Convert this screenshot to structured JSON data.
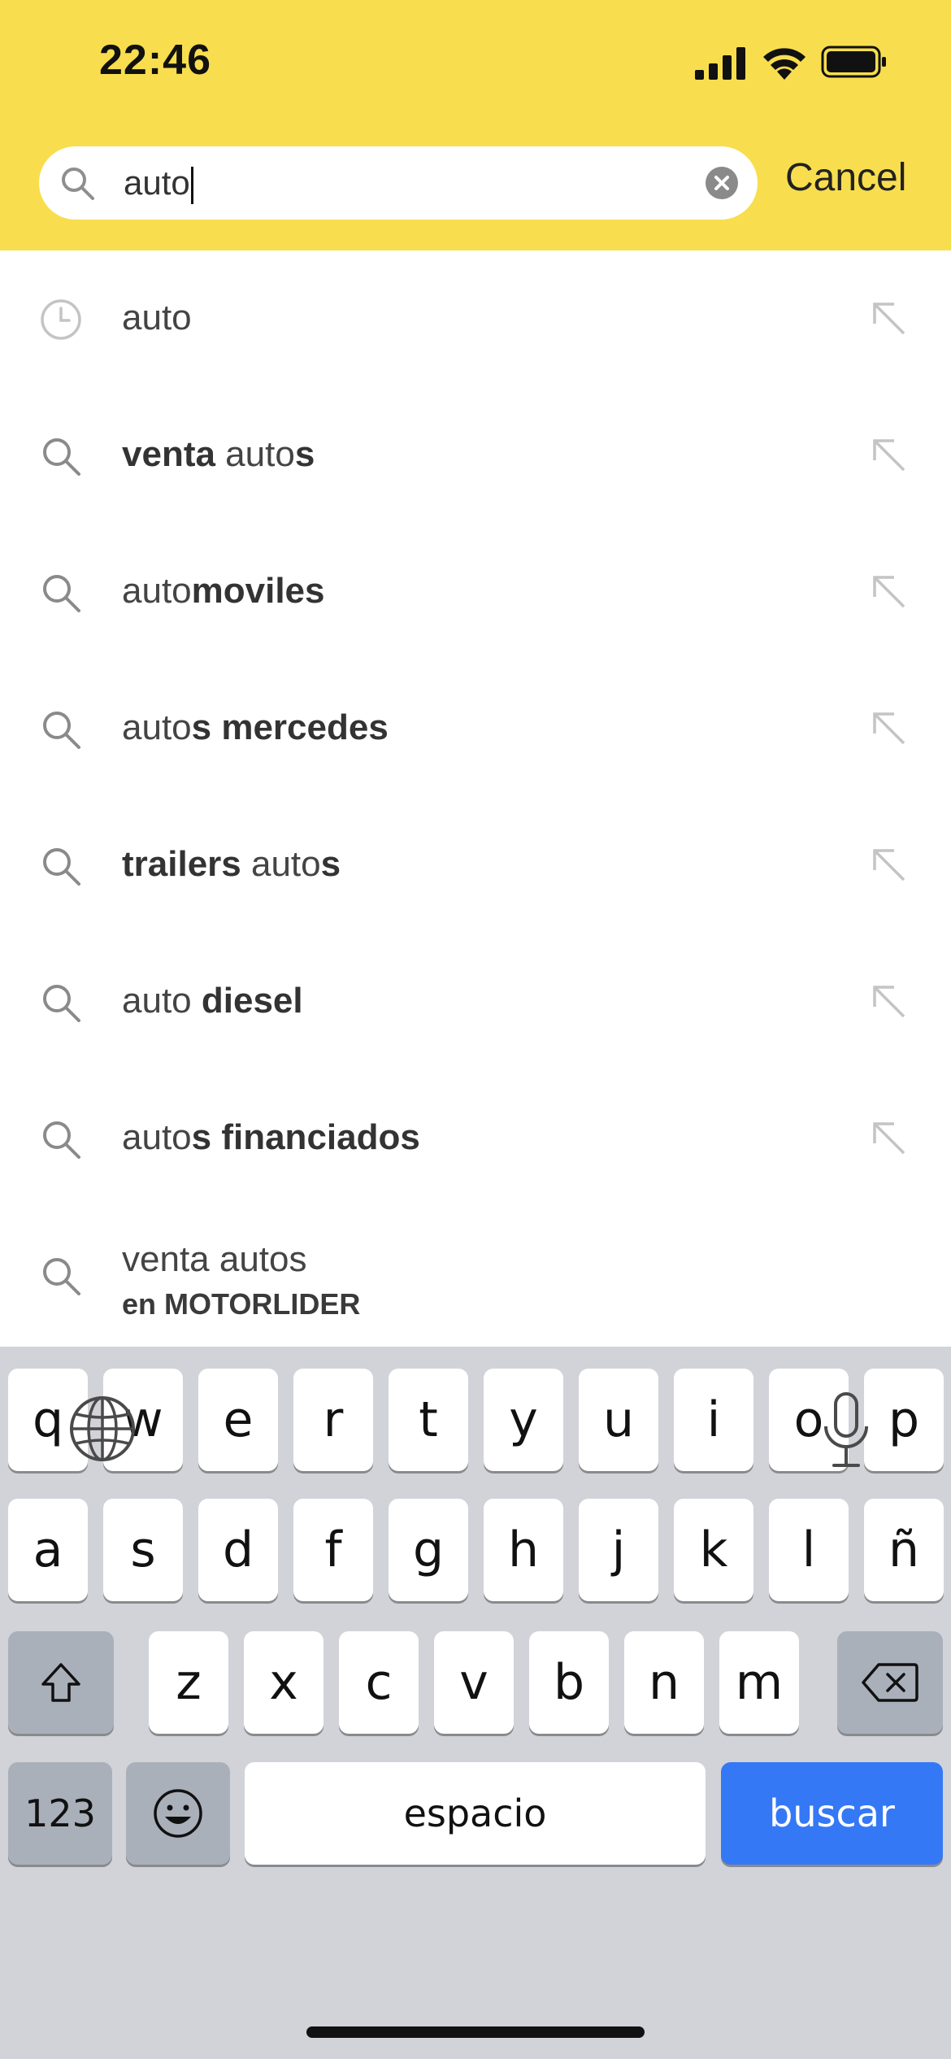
{
  "status_bar": {
    "time": "22:46"
  },
  "search": {
    "value": "auto",
    "cancel_label": "Cancel"
  },
  "suggestions": [
    {
      "icon": "clock-icon",
      "parts": [
        {
          "t": "auto",
          "b": false
        }
      ]
    },
    {
      "icon": "search-icon",
      "parts": [
        {
          "t": "venta",
          "b": true
        },
        {
          "t": " auto",
          "b": false
        },
        {
          "t": "s",
          "b": true
        }
      ]
    },
    {
      "icon": "search-icon",
      "parts": [
        {
          "t": "auto",
          "b": false
        },
        {
          "t": "moviles",
          "b": true
        }
      ]
    },
    {
      "icon": "search-icon",
      "parts": [
        {
          "t": "auto",
          "b": false
        },
        {
          "t": "s mercedes",
          "b": true
        }
      ]
    },
    {
      "icon": "search-icon",
      "parts": [
        {
          "t": "trailers",
          "b": true
        },
        {
          "t": " auto",
          "b": false
        },
        {
          "t": "s",
          "b": true
        }
      ]
    },
    {
      "icon": "search-icon",
      "parts": [
        {
          "t": "auto ",
          "b": false
        },
        {
          "t": "diesel",
          "b": true
        }
      ]
    },
    {
      "icon": "search-icon",
      "parts": [
        {
          "t": "auto",
          "b": false
        },
        {
          "t": "s financiados",
          "b": true
        }
      ]
    }
  ],
  "category_suggestion": {
    "text": "venta autos",
    "category": "en MOTORLIDER"
  },
  "keyboard": {
    "row1": [
      "q",
      "w",
      "e",
      "r",
      "t",
      "y",
      "u",
      "i",
      "o",
      "p"
    ],
    "row2": [
      "a",
      "s",
      "d",
      "f",
      "g",
      "h",
      "j",
      "k",
      "l",
      "ñ"
    ],
    "row3": [
      "z",
      "x",
      "c",
      "v",
      "b",
      "n",
      "m"
    ],
    "numbers_label": "123",
    "space_label": "espacio",
    "return_label": "buscar"
  },
  "colors": {
    "header": "#F8DE4E",
    "keyboard_bg": "#D1D3D9",
    "action_key": "#3478F6"
  }
}
